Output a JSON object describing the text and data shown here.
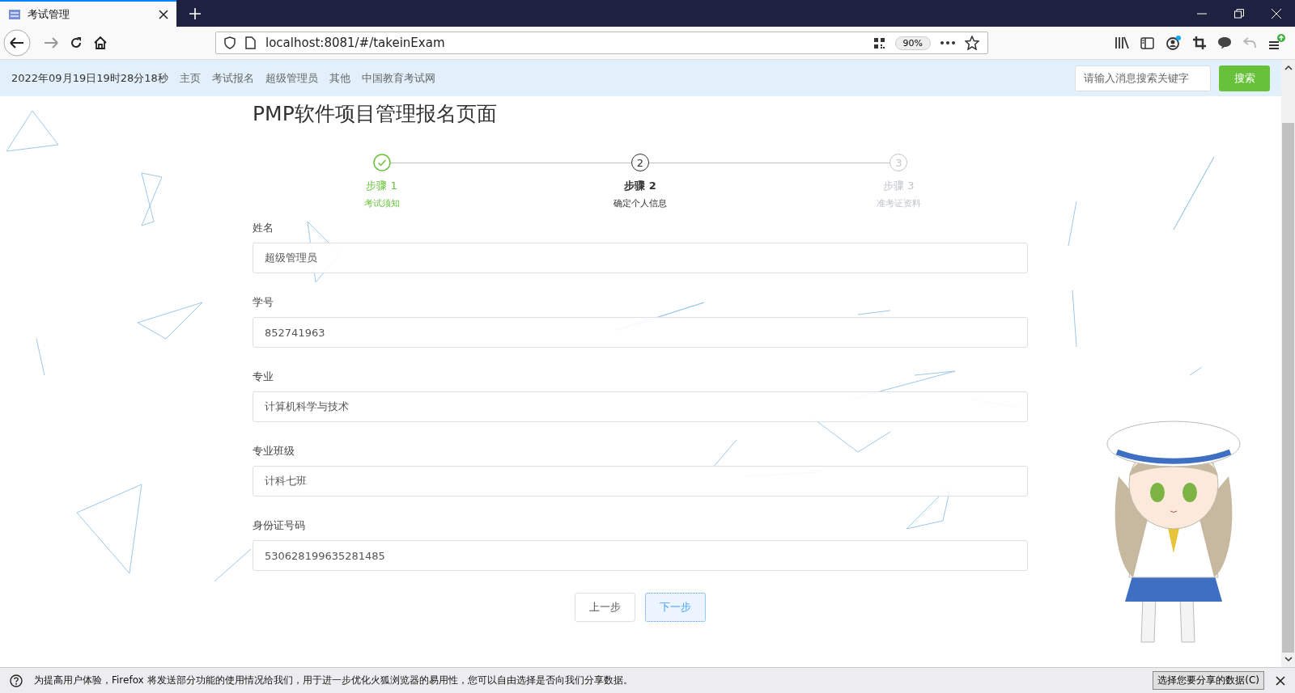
{
  "browser": {
    "tab_title": "考试管理",
    "url": "localhost:8081/#/takeinExam",
    "zoom": "90%"
  },
  "header": {
    "datetime": "2022年09月19日19时28分18秒",
    "nav": [
      "主页",
      "考试报名",
      "超级管理员",
      "其他",
      "中国教育考试网"
    ],
    "search": {
      "placeholder": "请输入消息搜索关键字"
    },
    "search_button": "搜索"
  },
  "title": "PMP软件项目管理报名页面",
  "steps": [
    {
      "title": "步骤 1",
      "description": "考试须知",
      "done": true,
      "selected": false
    },
    {
      "number": "2",
      "title": "步骤 2",
      "description": "确定个人信息",
      "done": false,
      "selected": true
    },
    {
      "number": "3",
      "title": "步骤 3",
      "description": "准考证资料",
      "done": false,
      "selected": false
    }
  ],
  "fields": [
    {
      "label": "姓名",
      "value": "超级管理员"
    },
    {
      "label": "学号",
      "value": "852741963"
    },
    {
      "label": "专业",
      "value": "计算机科学与技术"
    },
    {
      "label": "专业班级",
      "value": "计科七班"
    },
    {
      "label": "身份证号码",
      "value": "530628199635281485"
    }
  ],
  "buttons": [
    {
      "label": "上一步",
      "selected": false
    },
    {
      "label": "下一步",
      "selected": true
    }
  ],
  "notification": {
    "text": "为提高用户体验，Firefox 将发送部分功能的使用情况给我们，用于进一步优化火狐浏览器的易用性，您可以自由选择是否向我们分享数据。",
    "button": "选择您要分享的数据(C)"
  }
}
